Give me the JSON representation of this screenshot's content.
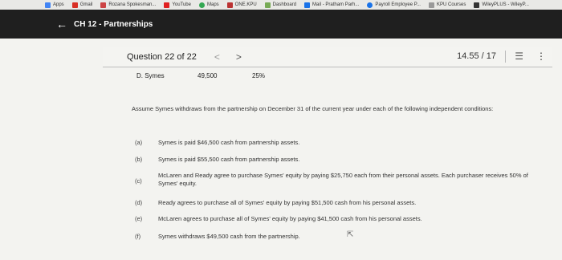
{
  "bookmarks": [
    {
      "label": "Apps",
      "color": "#4285f4"
    },
    {
      "label": "Gmail",
      "color": "#d93025"
    },
    {
      "label": "Rozana Spokesman...",
      "color": "#c44"
    },
    {
      "label": "YouTube",
      "color": "#e02020"
    },
    {
      "label": "Maps",
      "color": "#34a853"
    },
    {
      "label": "ONE.KPU",
      "color": "#b33"
    },
    {
      "label": "Dashboard",
      "color": "#7a5"
    },
    {
      "label": "Mail - Pratham Parh...",
      "color": "#1a73e8"
    },
    {
      "label": "Payroll Employee P...",
      "color": "#1a73e8"
    },
    {
      "label": "KPU Courses",
      "color": "#999"
    },
    {
      "label": "WileyPLUS - WileyP...",
      "color": "#333"
    }
  ],
  "appbar": {
    "back_icon": "←",
    "title": "CH 12 - Partnerships"
  },
  "question": {
    "title": "Question 22 of 22",
    "prev": "<",
    "next": ">",
    "progress": "14.55 / 17",
    "list_icon": "☰",
    "more_icon": "⋮"
  },
  "partner_row": {
    "name": "D. Symes",
    "value": "49,500",
    "percent": "25%"
  },
  "paragraph": "Assume Symes withdraws from the partnership on December 31 of the current year under each of the following independent conditions:",
  "items": [
    {
      "letter": "(a)",
      "text": "Symes is paid $46,500 cash from partnership assets."
    },
    {
      "letter": "(b)",
      "text": "Symes is paid $55,500 cash from partnership assets."
    },
    {
      "letter": "(c)",
      "text": "McLaren and Ready agree to purchase Symes' equity by paying $25,750 each from their personal assets. Each purchaser receives 50% of Symes' equity."
    },
    {
      "letter": "(d)",
      "text": "Ready agrees to purchase all of Symes' equity by paying $51,500 cash from his personal assets."
    },
    {
      "letter": "(e)",
      "text": "McLaren agrees to purchase all of Symes' equity by paying $41,500 cash from his personal assets."
    },
    {
      "letter": "(f)",
      "text": "Symes withdraws $49,500 cash from the partnership."
    }
  ]
}
